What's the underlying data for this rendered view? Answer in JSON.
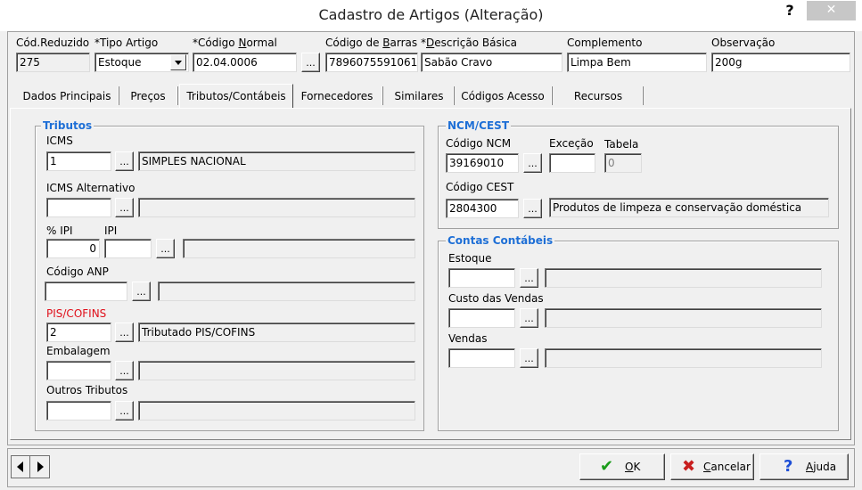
{
  "window": {
    "title": "Cadastro de Artigos (Alteração)",
    "help_label": "?",
    "close_label": "✕"
  },
  "header": {
    "cod_reduzido": {
      "label": "Cód.Reduzido",
      "value": "275"
    },
    "tipo_artigo": {
      "label": "*Tipo Artigo",
      "value": "Estoque"
    },
    "codigo_normal": {
      "label_pre": "*Código ",
      "label_u": "N",
      "label_post": "ormal",
      "value": "02.04.0006"
    },
    "codigo_barras": {
      "label_pre": "Código de ",
      "label_u": "B",
      "label_post": "arras",
      "value": "7896075591061"
    },
    "descricao_basica": {
      "label_pre": "*",
      "label_u": "D",
      "label_post": "escrição Básica",
      "value": "Sabão Cravo"
    },
    "complemento": {
      "label": "Complemento",
      "value": "Limpa Bem"
    },
    "observacao": {
      "label": "Observação",
      "value": "200g"
    }
  },
  "tabs": [
    {
      "label": "Dados Principais"
    },
    {
      "label": "Preços"
    },
    {
      "label": "Tributos/Contábeis"
    },
    {
      "label": "Fornecedores"
    },
    {
      "label": "Similares"
    },
    {
      "label": "Códigos Acesso"
    },
    {
      "label": "Recursos"
    }
  ],
  "tributos": {
    "title": "Tributos",
    "icms": {
      "label": "ICMS",
      "code": "1",
      "desc": "SIMPLES NACIONAL"
    },
    "icms_alt": {
      "label": "ICMS Alternativo",
      "code": "",
      "desc": ""
    },
    "pct_ipi": {
      "label": "% IPI",
      "value": "0"
    },
    "ipi": {
      "label": "IPI",
      "code": "",
      "desc": ""
    },
    "anp": {
      "label": "Código ANP",
      "code": "",
      "desc": ""
    },
    "pis_cofins": {
      "label": "PIS/COFINS",
      "code": "2",
      "desc": "Tributado PIS/COFINS"
    },
    "embalagem": {
      "label": "Embalagem",
      "code": "",
      "desc": ""
    },
    "outros": {
      "label": "Outros Tributos",
      "code": "",
      "desc": ""
    }
  },
  "ncm": {
    "title": "NCM/CEST",
    "codigo_ncm": {
      "label": "Código NCM",
      "value": "39169010"
    },
    "excecao": {
      "label": "Exceção",
      "value": ""
    },
    "tabela": {
      "label": "Tabela",
      "value": "0"
    },
    "codigo_cest": {
      "label": "Código CEST",
      "value": "2804300",
      "desc": "Produtos de limpeza e conservação doméstica"
    }
  },
  "contas": {
    "title": "Contas Contábeis",
    "estoque": {
      "label": "Estoque",
      "code": "",
      "desc": ""
    },
    "custo_vendas": {
      "label": "Custo das Vendas",
      "code": "",
      "desc": ""
    },
    "vendas": {
      "label": "Vendas",
      "code": "",
      "desc": ""
    }
  },
  "buttons": {
    "dots": "...",
    "ok": {
      "u": "O",
      "rest": "K"
    },
    "cancelar": {
      "u": "C",
      "rest": "ancelar"
    },
    "ajuda": {
      "u": "A",
      "rest": "juda"
    }
  },
  "colors": {
    "accent_title": "#1e6fd6",
    "required_red": "#e0101b",
    "ok_green": "#1a9c1a",
    "cancel_red": "#c81e1e",
    "help_blue": "#1e4fd6"
  }
}
